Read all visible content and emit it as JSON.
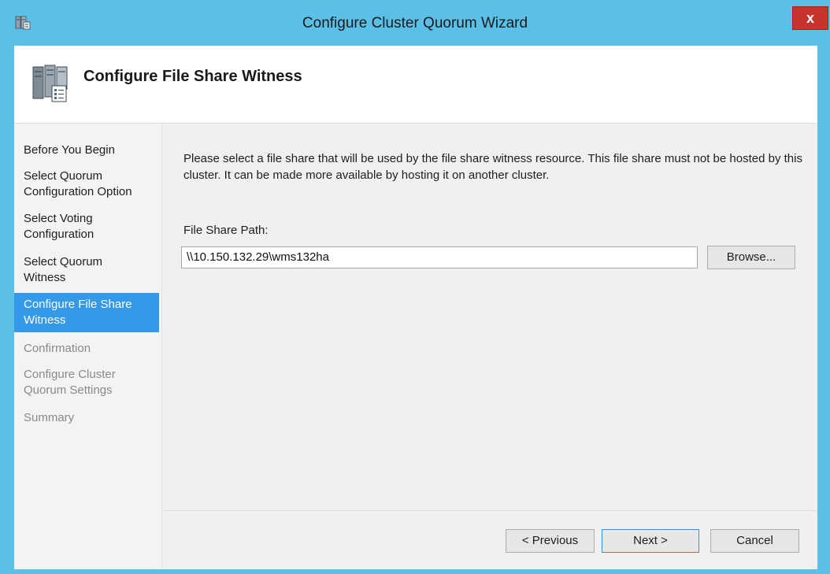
{
  "window": {
    "title": "Configure Cluster Quorum Wizard",
    "close_label": "x",
    "accent_color": "#5bc0e8"
  },
  "header": {
    "heading": "Configure File Share Witness"
  },
  "nav": {
    "items": [
      {
        "label": "Before You Begin",
        "state": "normal"
      },
      {
        "label": "Select Quorum Configuration Option",
        "state": "normal"
      },
      {
        "label": "Select Voting Configuration",
        "state": "normal"
      },
      {
        "label": "Select Quorum Witness",
        "state": "normal"
      },
      {
        "label": "Configure File Share Witness",
        "state": "active"
      },
      {
        "label": "Confirmation",
        "state": "disabled"
      },
      {
        "label": "Configure Cluster Quorum Settings",
        "state": "disabled"
      },
      {
        "label": "Summary",
        "state": "disabled"
      }
    ],
    "active_color": "#3399e8"
  },
  "content": {
    "description": "Please select a file share that will be used by the file share witness resource.  This file share must not be hosted by this cluster.  It can be made more available by hosting it on another cluster.",
    "path_label": "File Share Path:",
    "path_value": "\\\\10.150.132.29\\wms132ha",
    "browse_label": "Browse..."
  },
  "footer": {
    "previous_label": "< Previous",
    "next_label": "Next >",
    "cancel_label": "Cancel"
  }
}
